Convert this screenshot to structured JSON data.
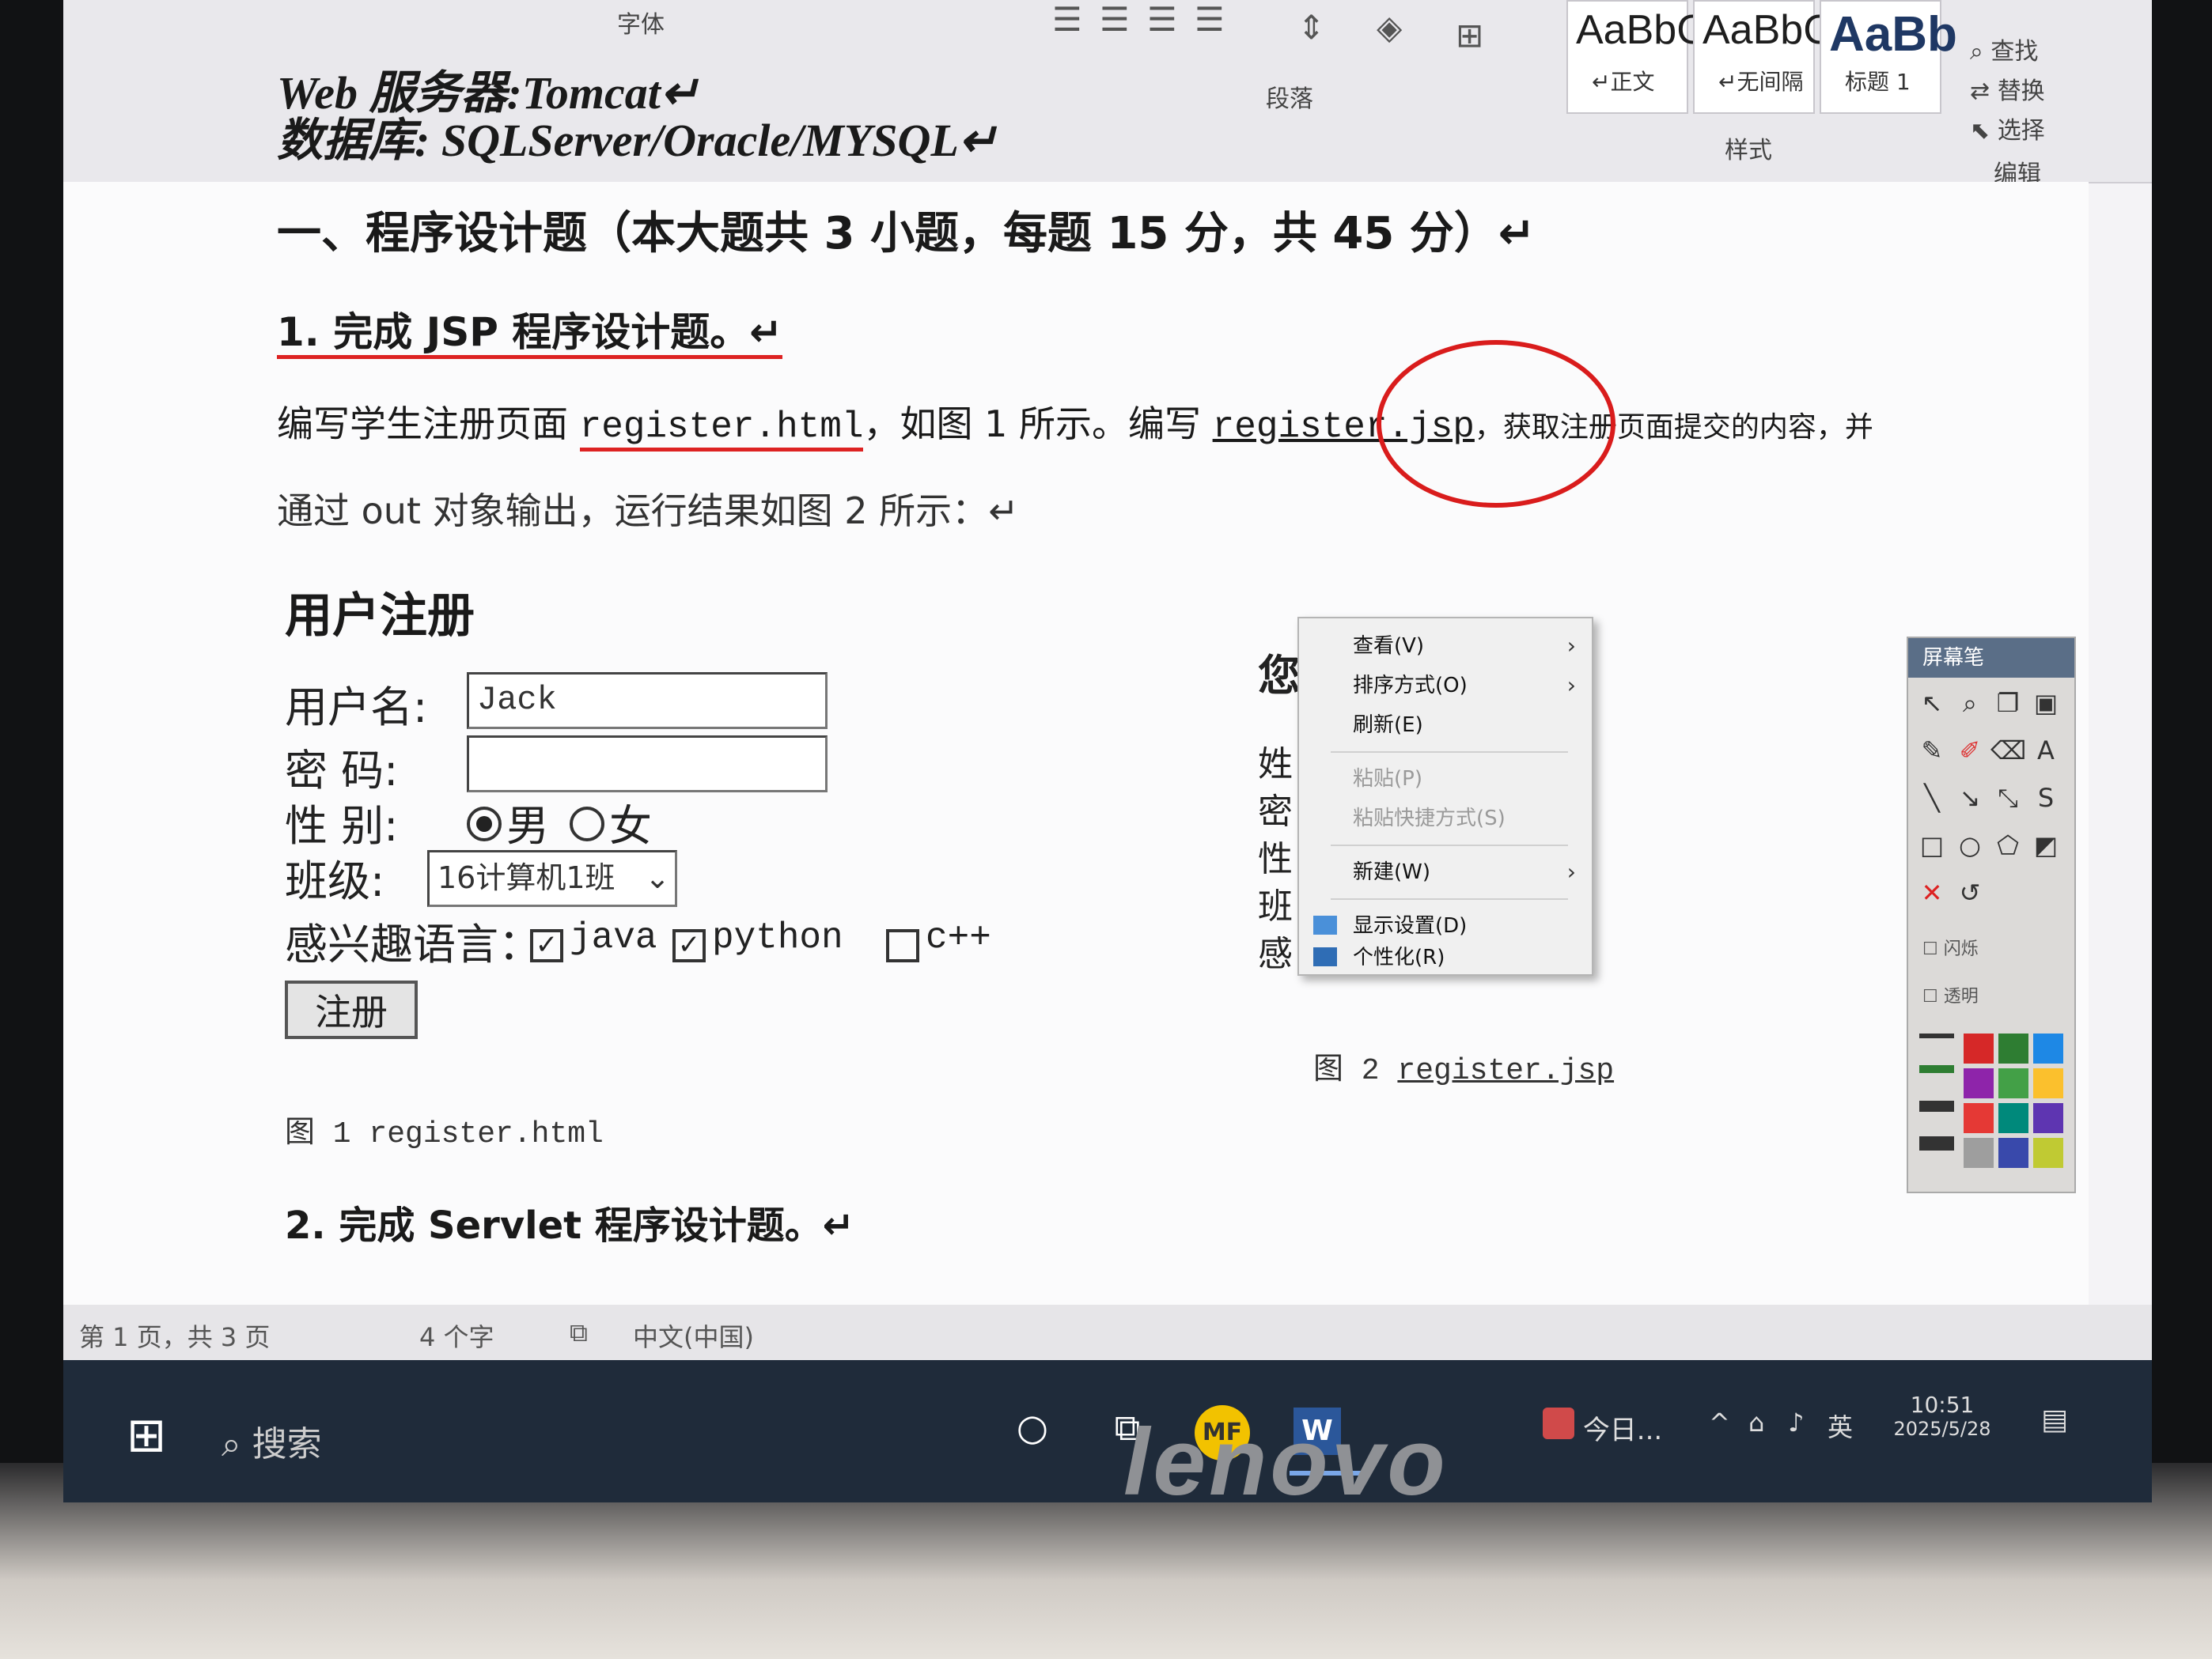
{
  "ribbon": {
    "font_group": "字体",
    "paragraph_group": "段落",
    "styles_group": "样式",
    "editing_group": "编辑",
    "styles": [
      {
        "preview": "AaBbC",
        "name": "↵正文"
      },
      {
        "preview": "AaBbC",
        "name": "↵无间隔"
      },
      {
        "preview": "AaBb",
        "name": "标题 1"
      }
    ],
    "find": "查找",
    "replace": "替换",
    "select": "选择"
  },
  "document": {
    "line_web_server": "Web 服务器:Tomcat↵",
    "line_database": "数据库: SQLServer/Oracle/MYSQL↵",
    "section_heading": "一、程序设计题（本大题共 3 小题，每题 15 分，共 45 分）↵",
    "q1_heading": "1. 完成 JSP 程序设计题。↵",
    "q1_desc_a": "编写学生注册页面 ",
    "q1_desc_file1": "register.html",
    "q1_desc_b": "，如图 1 所示。编写 ",
    "q1_desc_file2": "register.jsp",
    "q1_desc_c": "，获取注册页面提交的内容，并",
    "q1_desc_line2": "通过 out 对象输出，运行结果如图 2 所示：↵",
    "form": {
      "title": "用户注册",
      "username_label": "用户名:",
      "username_value": "Jack",
      "password_label": "密 码:",
      "gender_label": "性 别:",
      "gender_male": "男",
      "gender_female": "女",
      "class_label": "班级:",
      "class_value": "16计算机1班",
      "lang_label": "感兴趣语言：",
      "lang_java": "java",
      "lang_python": "python",
      "lang_cpp": "c++",
      "submit": "注册"
    },
    "fig1_caption": "图 1 register.html",
    "fig2_caption_prefix": "图 2 ",
    "fig2_caption_file": "register.jsp",
    "fig2_partial": [
      "姓",
      "密",
      "性",
      "班",
      "感"
    ],
    "fig2_partial_top": "您",
    "q2_heading": "2. 完成 Servlet 程序设计题。↵"
  },
  "context_menu": {
    "items": [
      {
        "label": "查看(V)",
        "submenu": true,
        "disabled": false
      },
      {
        "label": "排序方式(O)",
        "submenu": true,
        "disabled": false
      },
      {
        "label": "刷新(E)",
        "submenu": false,
        "disabled": false
      },
      {
        "label": "粘贴(P)",
        "submenu": false,
        "disabled": true
      },
      {
        "label": "粘贴快捷方式(S)",
        "submenu": false,
        "disabled": true
      },
      {
        "label": "新建(W)",
        "submenu": true,
        "disabled": false
      },
      {
        "label": "显示设置(D)",
        "submenu": false,
        "disabled": false
      },
      {
        "label": "个性化(R)",
        "submenu": false,
        "disabled": false
      }
    ]
  },
  "pen_toolbar": {
    "title": "屏幕笔",
    "option_blink": "闪烁",
    "option_transparent": "透明",
    "palette": [
      "#d62828",
      "#2e7d32",
      "#1e88e5",
      "#8e24aa",
      "#43a047",
      "#fbc02d",
      "#e53935",
      "#00897b",
      "#5e35b1",
      "#9e9e9e",
      "#3949ab",
      "#c0ca33"
    ]
  },
  "status_bar": {
    "page": "第 1 页，共 3 页",
    "words": "4 个字",
    "language": "中文(中国)"
  },
  "taskbar": {
    "search": "搜索",
    "news": "今日...",
    "ime": "英",
    "time": "10:51",
    "date": "2025/5/28",
    "app_mf": "MF",
    "app_word": "W"
  },
  "brand": "lenovo"
}
